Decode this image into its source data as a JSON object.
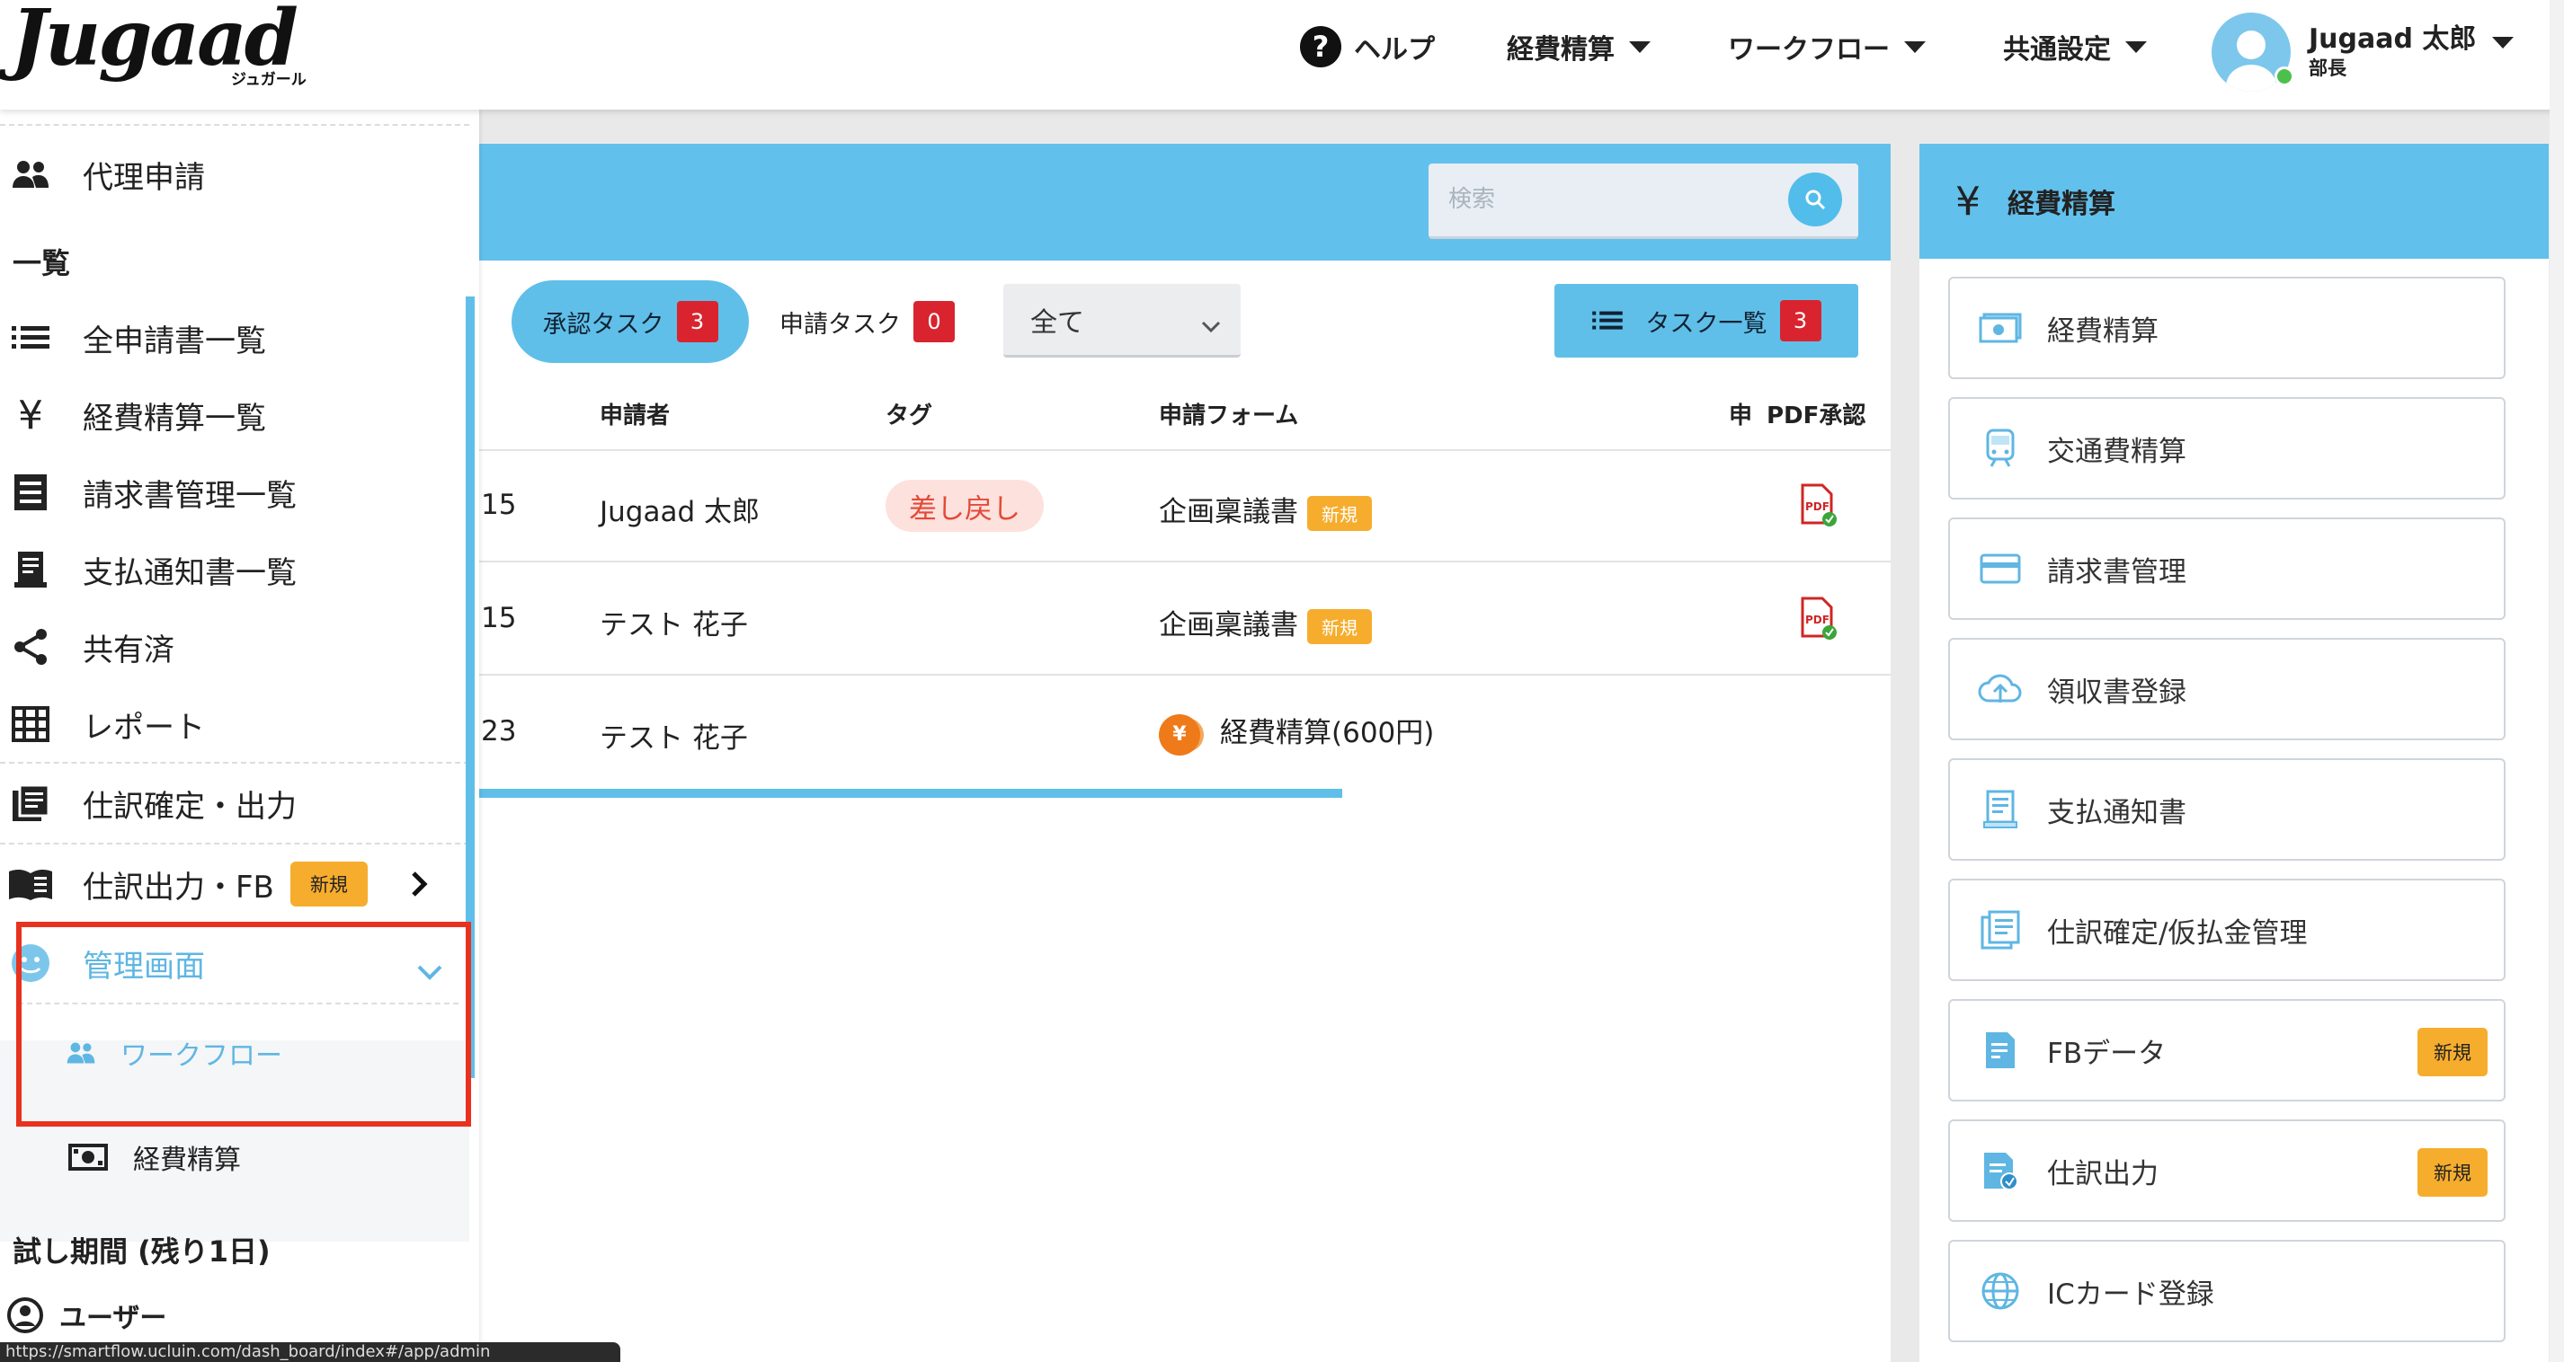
{
  "header": {
    "logo_text": "Jugaad",
    "logo_sub": "ジュガール",
    "nav": {
      "help": "ヘルプ",
      "expense": "経費精算",
      "workflow": "ワークフロー",
      "common_settings": "共通設定"
    },
    "user": {
      "name": "Jugaad 太郎",
      "role": "部長"
    }
  },
  "sidebar": {
    "proxy": "代理申請",
    "list_heading": "一覧",
    "items": [
      {
        "label": "全申請書一覧",
        "icon": "list-icon"
      },
      {
        "label": "経費精算一覧",
        "icon": "yen-icon"
      },
      {
        "label": "請求書管理一覧",
        "icon": "invoice-icon"
      },
      {
        "label": "支払通知書一覧",
        "icon": "receipt-icon"
      },
      {
        "label": "共有済",
        "icon": "share-icon"
      },
      {
        "label": "レポート",
        "icon": "grid-icon"
      }
    ],
    "journal_confirm": "仕訳確定・出力",
    "journal_fb": "仕訳出力・FB",
    "new_badge": "新規",
    "admin": "管理画面",
    "admin_workflow": "ワークフロー",
    "admin_expense": "経費精算",
    "trial": "試し期間 (残り1日)",
    "users": "ユーザー"
  },
  "main": {
    "search_placeholder": "検索",
    "tabs": {
      "approve": {
        "label": "承認タスク",
        "count": "3"
      },
      "apply": {
        "label": "申請タスク",
        "count": "0"
      }
    },
    "filter": {
      "selected": "全て"
    },
    "task_list": {
      "label": "タスク一覧",
      "count": "3"
    },
    "columns": [
      "申請者",
      "タグ",
      "申請フォーム",
      "申",
      "PDF承認"
    ],
    "rows": [
      {
        "date_fragment": "15",
        "applicant": "Jugaad 太郎",
        "tag": "差し戻し",
        "form": "企画稟議書",
        "new": "新規",
        "pdf": true
      },
      {
        "date_fragment": "15",
        "applicant": "テスト 花子",
        "tag": "",
        "form": "企画稟議書",
        "new": "新規",
        "pdf": true
      },
      {
        "date_fragment": "23",
        "applicant": "テスト 花子",
        "tag": "",
        "form": "経費精算(600円)",
        "coin": "¥",
        "pdf": false
      }
    ]
  },
  "right_panel": {
    "title": "経費精算",
    "yen_symbol": "¥",
    "cards": [
      {
        "label": "経費精算",
        "icon": "cash-icon"
      },
      {
        "label": "交通費精算",
        "icon": "train-icon"
      },
      {
        "label": "請求書管理",
        "icon": "card-icon"
      },
      {
        "label": "領収書登録",
        "icon": "cloud-upload-icon"
      },
      {
        "label": "支払通知書",
        "icon": "receipt-icon"
      },
      {
        "label": "仕訳確定/仮払金管理",
        "icon": "journal-icon"
      },
      {
        "label": "FBデータ",
        "icon": "fb-data-icon",
        "badge": "新規"
      },
      {
        "label": "仕訳出力",
        "icon": "journal-export-icon",
        "badge": "新規"
      },
      {
        "label": "ICカード登録",
        "icon": "globe-icon"
      }
    ]
  },
  "status_url": "https://smartflow.ucluin.com/dash_board/index#/app/admin",
  "colors": {
    "accent": "#62c0ec",
    "danger": "#d9242f",
    "badge": "#f6ad2d",
    "highlight": "#e8321f"
  }
}
